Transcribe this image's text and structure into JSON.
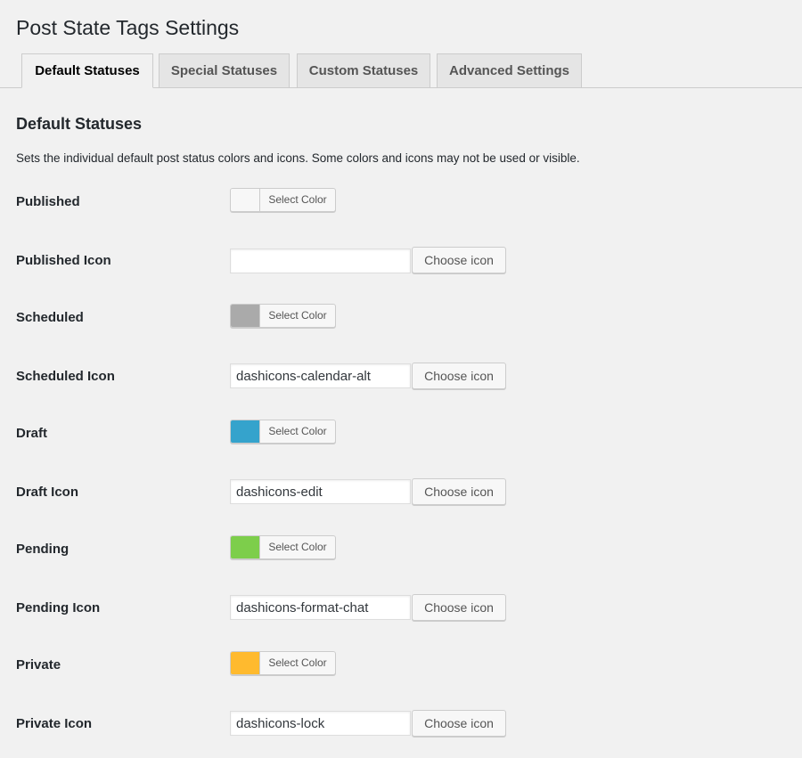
{
  "page": {
    "title": "Post State Tags Settings"
  },
  "tabs": [
    {
      "label": "Default Statuses",
      "active": true
    },
    {
      "label": "Special Statuses",
      "active": false
    },
    {
      "label": "Custom Statuses",
      "active": false
    },
    {
      "label": "Advanced Settings",
      "active": false
    }
  ],
  "section": {
    "title": "Default Statuses",
    "description": "Sets the individual default post status colors and icons. Some colors and icons may not be used or visible."
  },
  "controls": {
    "select_color_label": "Select Color",
    "choose_icon_label": "Choose icon"
  },
  "statuses": [
    {
      "label": "Published",
      "color": "#f7f7f7",
      "icon_label": "Published Icon",
      "icon_value": ""
    },
    {
      "label": "Scheduled",
      "color": "#aaaaaa",
      "icon_label": "Scheduled Icon",
      "icon_value": "dashicons-calendar-alt"
    },
    {
      "label": "Draft",
      "color": "#35a3cc",
      "icon_label": "Draft Icon",
      "icon_value": "dashicons-edit"
    },
    {
      "label": "Pending",
      "color": "#7dce4b",
      "icon_label": "Pending Icon",
      "icon_value": "dashicons-format-chat"
    },
    {
      "label": "Private",
      "color": "#ffba2e",
      "icon_label": "Private Icon",
      "icon_value": "dashicons-lock"
    }
  ]
}
